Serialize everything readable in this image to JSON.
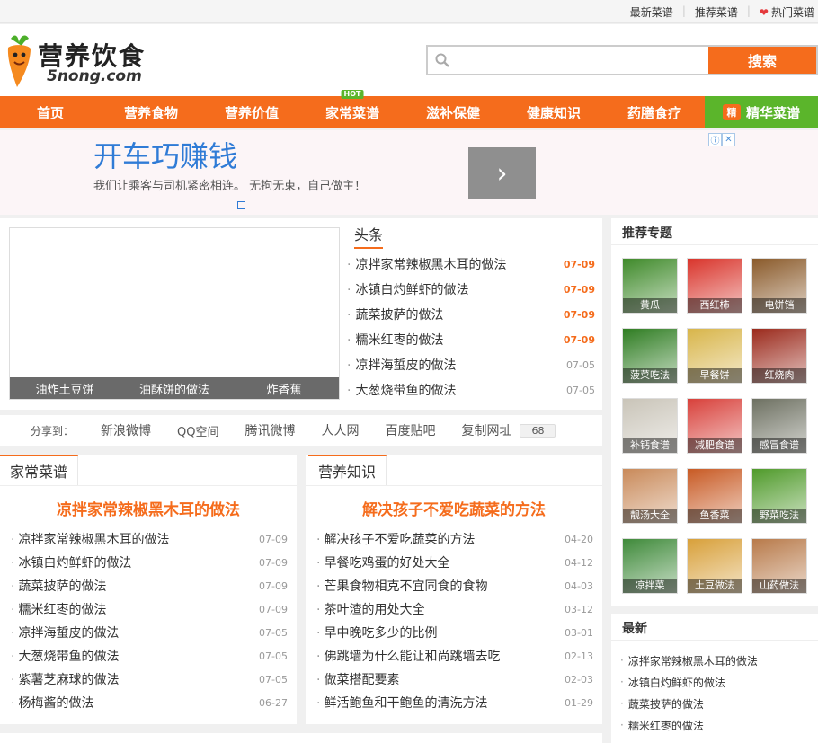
{
  "toplinks": {
    "latest": "最新菜谱",
    "recommended": "推荐菜谱",
    "hot": "热门菜谱"
  },
  "logo": {
    "name": "营养饮食",
    "domain": "5nong.com"
  },
  "search": {
    "placeholder": "",
    "button": "搜索"
  },
  "nav": {
    "items": [
      "首页",
      "营养食物",
      "营养价值",
      "家常菜谱",
      "滋补保健",
      "健康知识",
      "药膳食疗"
    ],
    "hot_badge": "HOT",
    "special": {
      "badge": "精",
      "label": "精华菜谱"
    },
    "colors": {
      "primary": "#f56c1c",
      "special": "#5bb52b"
    }
  },
  "ad": {
    "title": "开车巧赚钱",
    "desc": "我们让乘客与司机紧密相连。 无拘无束，自己做主！"
  },
  "slider": {
    "captions": [
      "油炸土豆饼",
      "油酥饼的做法",
      "炸香蕉"
    ]
  },
  "headline": {
    "title": "头条",
    "items": [
      {
        "title": "凉拌家常辣椒黑木耳的做法",
        "date": "07-09"
      },
      {
        "title": "冰镇白灼鲜虾的做法",
        "date": "07-09"
      },
      {
        "title": "蔬菜披萨的做法",
        "date": "07-09"
      },
      {
        "title": "糯米红枣的做法",
        "date": "07-09"
      },
      {
        "title": "凉拌海蜇皮的做法",
        "date": "07-05"
      },
      {
        "title": "大葱烧带鱼的做法",
        "date": "07-05"
      }
    ]
  },
  "share": {
    "label": "分享到：",
    "targets": [
      "新浪微博",
      "QQ空间",
      "腾讯微博",
      "人人网",
      "百度贴吧",
      "复制网址"
    ],
    "count": "68"
  },
  "home_recipes": {
    "tab": "家常菜谱",
    "feature": "凉拌家常辣椒黑木耳的做法",
    "items": [
      {
        "title": "凉拌家常辣椒黑木耳的做法",
        "date": "07-09"
      },
      {
        "title": "冰镇白灼鲜虾的做法",
        "date": "07-09"
      },
      {
        "title": "蔬菜披萨的做法",
        "date": "07-09"
      },
      {
        "title": "糯米红枣的做法",
        "date": "07-09"
      },
      {
        "title": "凉拌海蜇皮的做法",
        "date": "07-05"
      },
      {
        "title": "大葱烧带鱼的做法",
        "date": "07-05"
      },
      {
        "title": "紫薯芝麻球的做法",
        "date": "07-05"
      },
      {
        "title": "杨梅酱的做法",
        "date": "06-27"
      }
    ]
  },
  "nutrition": {
    "tab": "营养知识",
    "feature": "解决孩子不爱吃蔬菜的方法",
    "items": [
      {
        "title": "解决孩子不爱吃蔬菜的方法",
        "date": "04-20"
      },
      {
        "title": "早餐吃鸡蛋的好处大全",
        "date": "04-12"
      },
      {
        "title": "芒果食物相克不宜同食的食物",
        "date": "04-03"
      },
      {
        "title": "茶叶渣的用处大全",
        "date": "03-12"
      },
      {
        "title": "早中晚吃多少的比例",
        "date": "03-01"
      },
      {
        "title": "佛跳墙为什么能让和尚跳墙去吃",
        "date": "02-13"
      },
      {
        "title": "做菜搭配要素",
        "date": "02-03"
      },
      {
        "title": "鲜活鲍鱼和干鲍鱼的清洗方法",
        "date": "01-29"
      }
    ]
  },
  "topics": {
    "title": "推荐专题",
    "items": [
      {
        "label": "黄瓜",
        "color": "#3f8a2a"
      },
      {
        "label": "西红柿",
        "color": "#d9342b"
      },
      {
        "label": "电饼铛",
        "color": "#8a5a2a"
      },
      {
        "label": "菠菜吃法",
        "color": "#2f7d22"
      },
      {
        "label": "早餐饼",
        "color": "#d8b54a"
      },
      {
        "label": "红烧肉",
        "color": "#9b2a1c"
      },
      {
        "label": "补钙食谱",
        "color": "#c9c4b8"
      },
      {
        "label": "减肥食谱",
        "color": "#d8403a"
      },
      {
        "label": "感冒食谱",
        "color": "#6d7061"
      },
      {
        "label": "靓汤大全",
        "color": "#c98a5a"
      },
      {
        "label": "鱼香菜",
        "color": "#c85a24"
      },
      {
        "label": "野菜吃法",
        "color": "#4f9a2a"
      },
      {
        "label": "凉拌菜",
        "color": "#3f8a3a"
      },
      {
        "label": "土豆做法",
        "color": "#d8a03a"
      },
      {
        "label": "山药做法",
        "color": "#b87a4a"
      }
    ]
  },
  "latest": {
    "title": "最新",
    "items": [
      "凉拌家常辣椒黑木耳的做法",
      "冰镇白灼鲜虾的做法",
      "蔬菜披萨的做法",
      "糯米红枣的做法"
    ]
  }
}
